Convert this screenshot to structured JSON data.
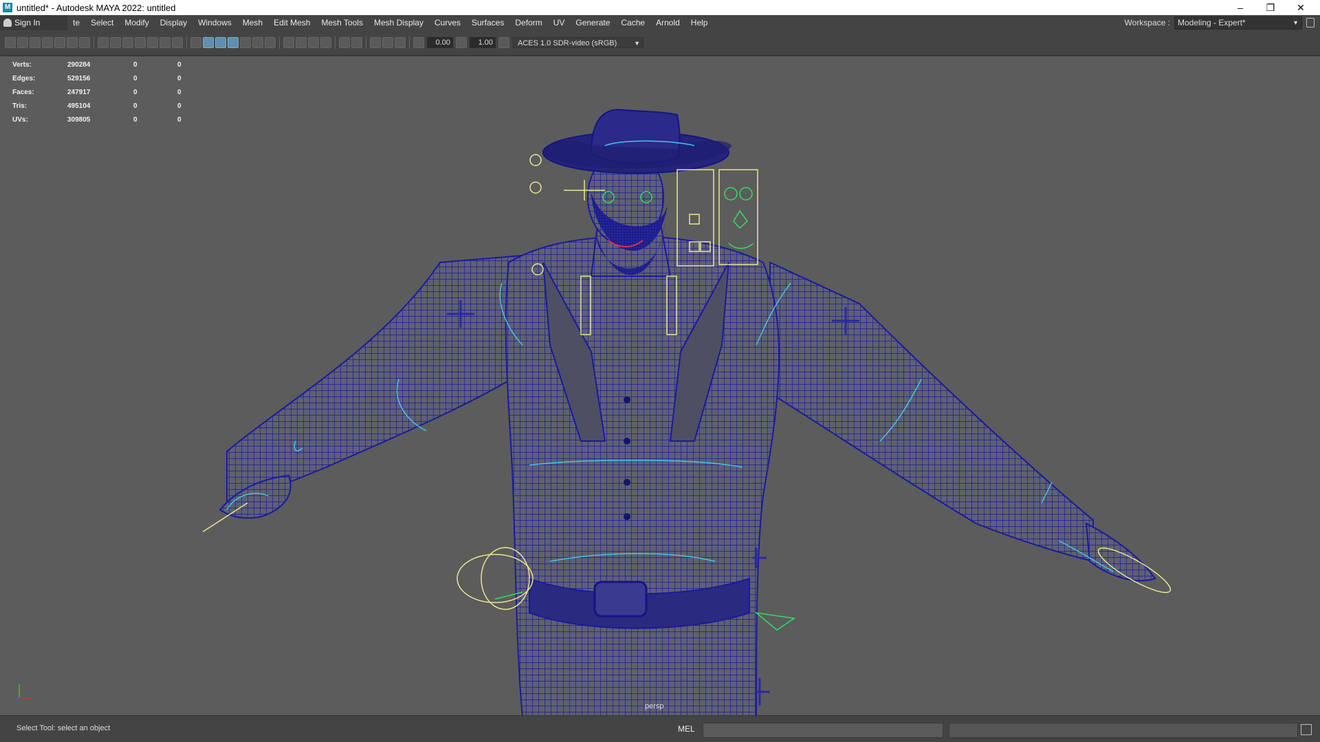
{
  "window": {
    "title": "untitled* - Autodesk MAYA 2022: untitled",
    "icon": "maya-logo-icon",
    "controls": [
      "minimize-icon",
      "restore-icon",
      "close-icon"
    ]
  },
  "menubar": {
    "sign_in": "Sign In",
    "items": [
      "te",
      "Select",
      "Modify",
      "Display",
      "Windows",
      "Mesh",
      "Edit Mesh",
      "Mesh Tools",
      "Mesh Display",
      "Curves",
      "Surfaces",
      "Deform",
      "UV",
      "Generate",
      "Cache",
      "Arnold",
      "Help"
    ],
    "workspace_label": "Workspace :",
    "workspace_value": "Modeling - Expert*"
  },
  "toolbar": {
    "exposure": "0.00",
    "gamma": "1.00",
    "color_space": "ACES 1.0 SDR-video (sRGB)"
  },
  "hud": {
    "rows": [
      {
        "label": "Verts:",
        "values": [
          "290284",
          "0",
          "0"
        ]
      },
      {
        "label": "Edges:",
        "values": [
          "529156",
          "0",
          "0"
        ]
      },
      {
        "label": "Faces:",
        "values": [
          "247917",
          "0",
          "0"
        ]
      },
      {
        "label": "Tris:",
        "values": [
          "495104",
          "0",
          "0"
        ]
      },
      {
        "label": "UVs:",
        "values": [
          "309805",
          "0",
          "0"
        ]
      }
    ]
  },
  "viewport": {
    "camera": "persp",
    "wire_color": "#1a1aa0",
    "control_yellow": "#e8e890",
    "control_cyan": "#40c8e8",
    "control_green": "#30e060"
  },
  "status": {
    "help_line": "Select Tool: select an object",
    "mel_label": "MEL"
  }
}
